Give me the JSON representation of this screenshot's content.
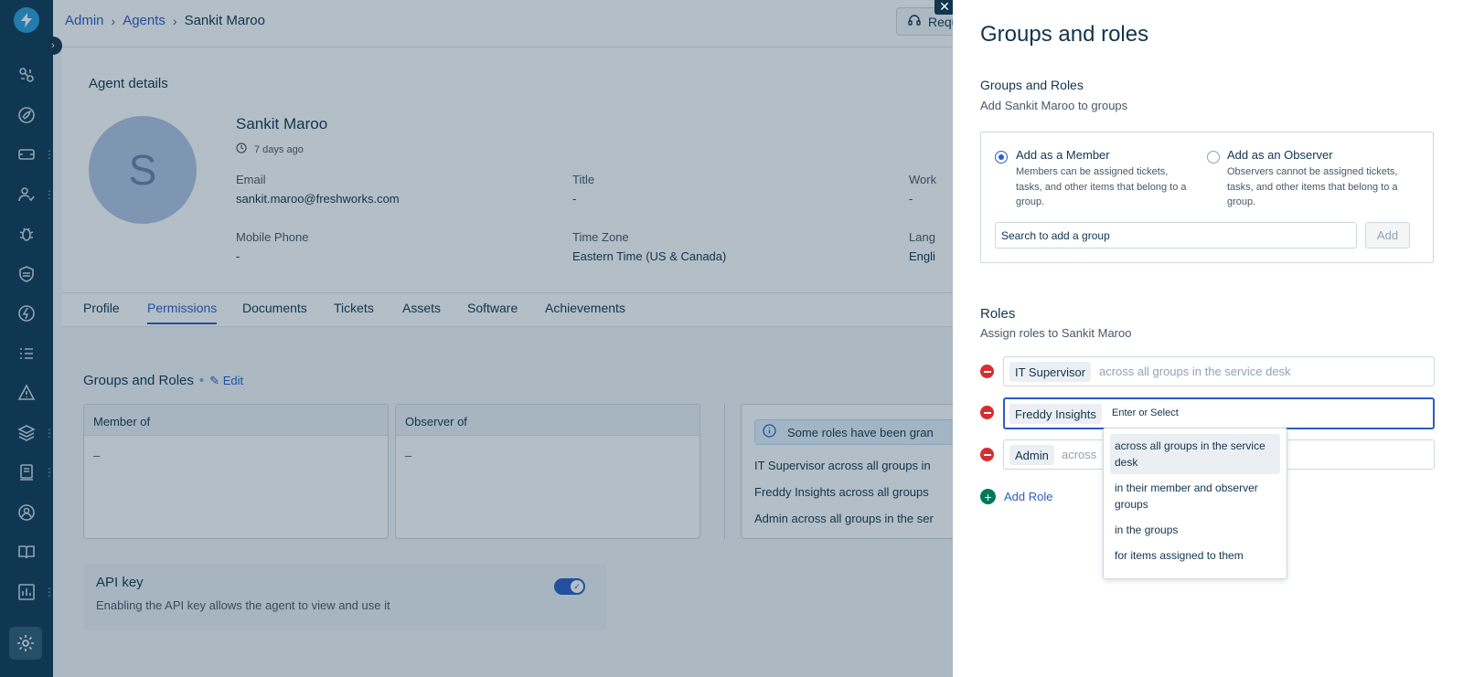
{
  "breadcrumb": {
    "admin": "Admin",
    "agents": "Agents",
    "current": "Sankit Maroo"
  },
  "header": {
    "request_button": "Requ"
  },
  "agent": {
    "section_title": "Agent details",
    "avatar_letter": "S",
    "name": "Sankit Maroo",
    "last_seen": "7 days ago",
    "fields": {
      "email_label": "Email",
      "email_value": "sankit.maroo@freshworks.com",
      "title_label": "Title",
      "title_value": "-",
      "work_label": "Work",
      "work_value": "-",
      "mobile_label": "Mobile Phone",
      "mobile_value": "-",
      "timezone_label": "Time Zone",
      "timezone_value": "Eastern Time (US & Canada)",
      "lang_label": "Lang",
      "lang_value": "Engli"
    }
  },
  "tabs": [
    "Profile",
    "Permissions",
    "Documents",
    "Tickets",
    "Assets",
    "Software",
    "Achievements"
  ],
  "groups_roles": {
    "title": "Groups and Roles",
    "edit_label": "Edit",
    "member_of_header": "Member of",
    "member_of_value": "–",
    "observer_of_header": "Observer of",
    "observer_of_value": "–",
    "info_banner": "Some roles have been gran",
    "info_lines": [
      "IT Supervisor across all groups in",
      "Freddy Insights across all groups",
      "Admin across all groups in the ser"
    ]
  },
  "api_key": {
    "title": "API key",
    "desc": "Enabling the API key allows the agent to view and use it",
    "enabled": true
  },
  "panel": {
    "title": "Groups and roles",
    "groups_section_title": "Groups and Roles",
    "groups_section_sub": "Add Sankit Maroo to groups",
    "member_option": {
      "title": "Add as a Member",
      "desc": "Members can be assigned tickets, tasks, and other items that belong to a group.",
      "selected": true
    },
    "observer_option": {
      "title": "Add as an Observer",
      "desc": "Observers cannot be assigned tickets, tasks, and other items that belong to a group.",
      "selected": false
    },
    "group_search_value": "Search to add a group",
    "add_button": "Add",
    "roles_title": "Roles",
    "roles_sub": "Assign roles to Sankit Maroo",
    "roles": [
      {
        "name": "IT Supervisor",
        "scope": "across all groups in the service desk"
      },
      {
        "name": "Freddy Insights",
        "scope": "Enter or Select"
      },
      {
        "name": "Admin",
        "scope": "across"
      }
    ],
    "add_role": "Add Role",
    "scope_options": [
      "across all groups in the service desk",
      "in their member and observer groups",
      "in the groups",
      "for items assigned to them"
    ]
  },
  "colors": {
    "sidebar": "#0f3954",
    "accent": "#2c5cc5",
    "remove": "#d72d30",
    "add": "#00795b"
  }
}
